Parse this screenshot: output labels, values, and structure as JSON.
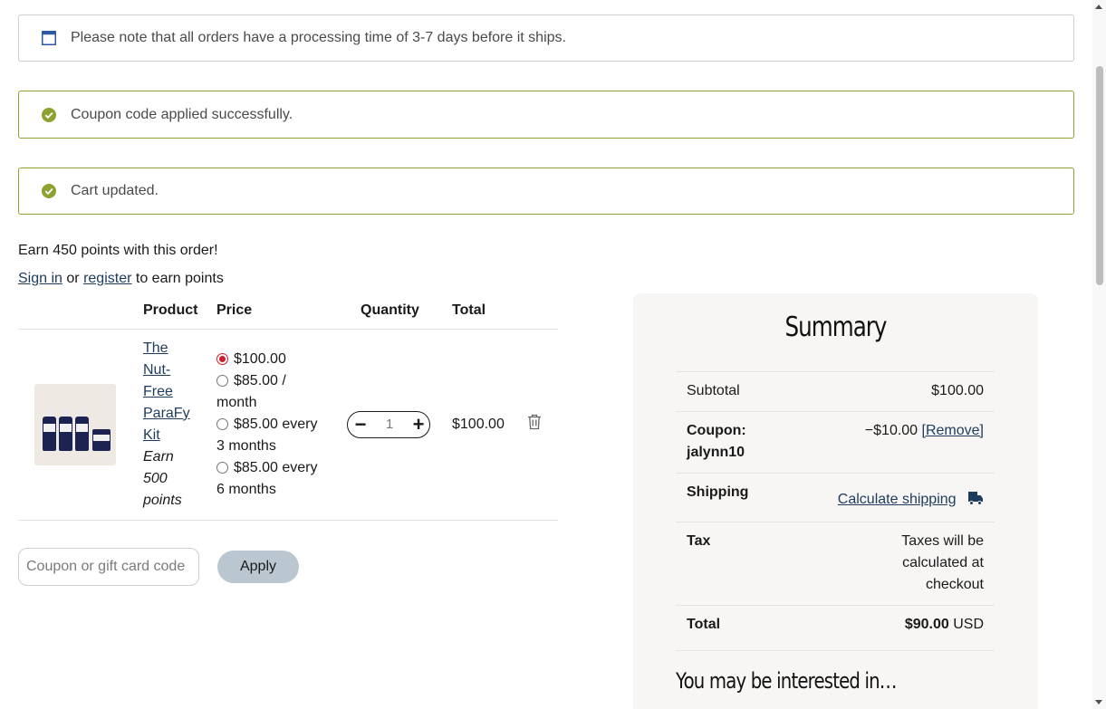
{
  "notices": {
    "processing": "Please note that all orders have a processing time of 3-7 days before it ships.",
    "coupon_applied": "Coupon code applied successfully.",
    "cart_updated": "Cart updated."
  },
  "points": {
    "earn_text": "Earn 450 points with this order!",
    "sign_in": "Sign in",
    "or": "or",
    "register": "register",
    "suffix": "to earn points"
  },
  "cart": {
    "headers": {
      "product": "Product",
      "price": "Price",
      "quantity": "Quantity",
      "total": "Total"
    },
    "item": {
      "name": "The Nut-Free ParaFy Kit",
      "earn": "Earn 500 points",
      "options": [
        {
          "label": "$100.00",
          "selected": true
        },
        {
          "label": "$85.00 / month",
          "selected": false
        },
        {
          "label": "$85.00 every 3 months",
          "selected": false
        },
        {
          "label": "$85.00 every 6 months",
          "selected": false
        }
      ],
      "quantity": "1",
      "total": "$100.00"
    }
  },
  "coupon": {
    "placeholder": "Coupon or gift card code",
    "apply_label": "Apply"
  },
  "summary": {
    "title": "Summary",
    "subtotal_label": "Subtotal",
    "subtotal_value": "$100.00",
    "coupon_label": "Coupon:",
    "coupon_code": "jalynn10",
    "coupon_value": "−$10.00",
    "remove_label": "[Remove]",
    "shipping_label": "Shipping",
    "shipping_link": "Calculate shipping",
    "tax_label": "Tax",
    "tax_value": "Taxes will be calculated at checkout",
    "total_label": "Total",
    "total_value": "$90.00",
    "total_currency": "USD"
  },
  "interested_heading": "You may be interested in…",
  "colors": {
    "success_border": "#8ea232",
    "success_icon": "#8ea232",
    "info_icon": "#2c5aa0",
    "link": "#1d3b5c",
    "radio_selected": "#d11c2b",
    "apply_bg": "#bac7d0",
    "summary_bg": "#f7f6f4"
  }
}
